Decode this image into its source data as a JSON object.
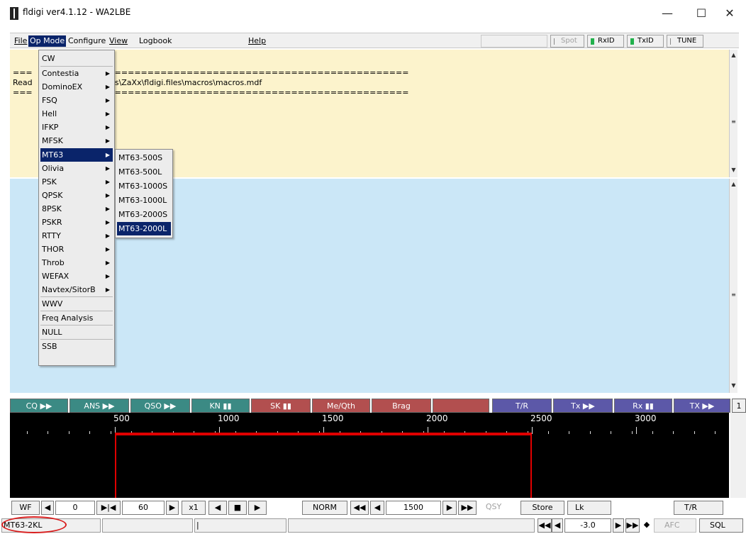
{
  "window": {
    "title": "fldigi ver4.1.12 - WA2LBE",
    "minimize": "—",
    "maximize": "☐",
    "close": "✕"
  },
  "menubar": {
    "file": "File",
    "opmode": "Op Mode",
    "configure": "Configure",
    "view": "View",
    "logbook": "Logbook",
    "help": "Help",
    "spot": "Spot",
    "rxid": "RxID",
    "txid": "TxID",
    "tune": "TUNE"
  },
  "rx": {
    "line1": "===                    ==================================================",
    "line2": "Read                         \\Users\\ZaXx\\fldigi.files\\macros\\macros.mdf",
    "line3": "===                    =================================================="
  },
  "opmode_menu": [
    {
      "label": "CW",
      "submenu": false
    },
    {
      "label": "Contestia",
      "submenu": true
    },
    {
      "label": "DominoEX",
      "submenu": true
    },
    {
      "label": "FSQ",
      "submenu": true
    },
    {
      "label": "Hell",
      "submenu": true
    },
    {
      "label": "IFKP",
      "submenu": true
    },
    {
      "label": "MFSK",
      "submenu": true
    },
    {
      "label": "MT63",
      "submenu": true
    },
    {
      "label": "Olivia",
      "submenu": true
    },
    {
      "label": "PSK",
      "submenu": true
    },
    {
      "label": "QPSK",
      "submenu": true
    },
    {
      "label": "8PSK",
      "submenu": true
    },
    {
      "label": "PSKR",
      "submenu": true
    },
    {
      "label": "RTTY",
      "submenu": true
    },
    {
      "label": "THOR",
      "submenu": true
    },
    {
      "label": "Throb",
      "submenu": true
    },
    {
      "label": "WEFAX",
      "submenu": true
    },
    {
      "label": "Navtex/SitorB",
      "submenu": true
    },
    {
      "label": "WWV",
      "submenu": false
    },
    {
      "label": "Freq Analysis",
      "submenu": false
    },
    {
      "label": "NULL",
      "submenu": false
    },
    {
      "label": "SSB",
      "submenu": false
    }
  ],
  "mt63_submenu": [
    "MT63-500S",
    "MT63-500L",
    "MT63-1000S",
    "MT63-1000L",
    "MT63-2000S",
    "MT63-2000L"
  ],
  "macros": {
    "cq": "CQ ▶▶",
    "ans": "ANS ▶▶",
    "qso": "QSO ▶▶",
    "kn": "KN ▮▮",
    "sk": "SK ▮▮",
    "meqth": "Me/Qth",
    "brag": "Brag",
    "blank": "",
    "tr": "T/R",
    "tx": "Tx ▶▶",
    "rx": "Rx ▮▮",
    "txk": "TX ▶▶",
    "page": "1"
  },
  "waterfall": {
    "ticks": [
      "500",
      "1000",
      "1500",
      "2000",
      "2500",
      "3000"
    ]
  },
  "controls": {
    "wf": "WF",
    "prev": "◀",
    "zero": "0",
    "ff": "▶|◀",
    "sixty": "60",
    "next": "▶",
    "x1": "x1",
    "left": "◀",
    "stop": "■",
    "right": "▶",
    "norm": "NORM",
    "rew2": "◀◀",
    "rew1": "◀",
    "freq": "1500",
    "fwd1": "▶",
    "fwd2": "▶▶",
    "qsy": "QSY",
    "store": "Store",
    "lk": "Lk",
    "tr": "T/R"
  },
  "status": {
    "mode": "MT63-2KL",
    "cursor": "|",
    "rew2": "◀◀",
    "rew1": "◀",
    "value": "-3.0",
    "fwd1": "▶",
    "fwd2": "▶▶",
    "diamond": "◆",
    "afc": "AFC",
    "sql": "SQL"
  }
}
